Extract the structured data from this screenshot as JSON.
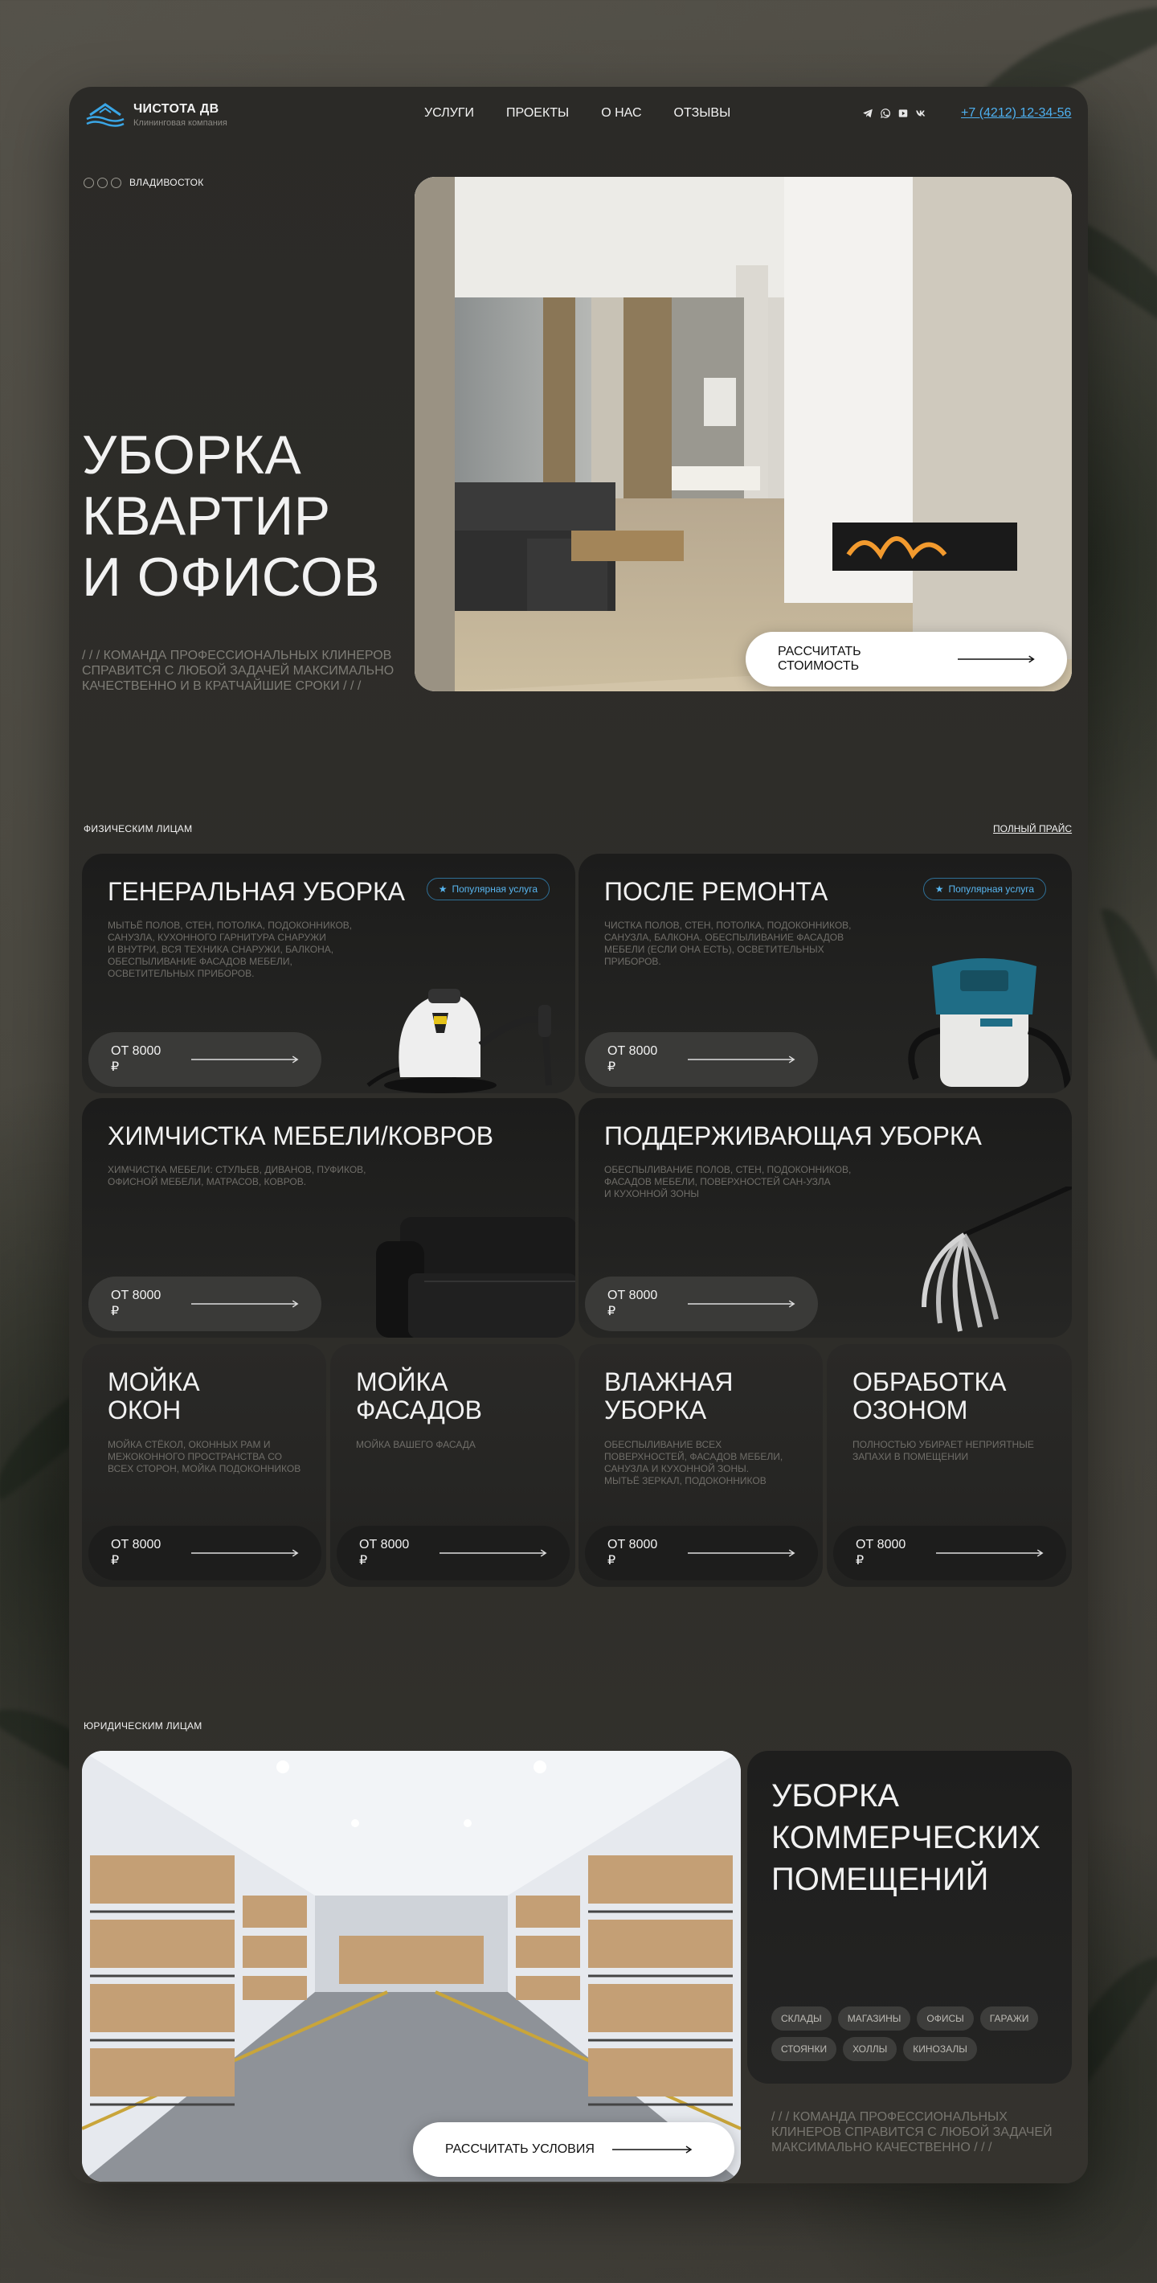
{
  "brand": {
    "title": "ЧИСТОТА ДВ",
    "subtitle": "Клининговая компания"
  },
  "nav": [
    "УСЛУГИ",
    "ПРОЕКТЫ",
    "О НАС",
    "ОТЗЫВЫ"
  ],
  "phone": "+7 (4212) 12-34-56",
  "socials": [
    "telegram-icon",
    "whatsapp-icon",
    "youtube-icon",
    "vk-icon"
  ],
  "hero": {
    "city": "ВЛАДИВОСТОК",
    "title": "УБОРКА\nКВАРТИР\nИ ОФИСОВ",
    "subtitle": "/ / / КОМАНДА ПРОФЕССИОНАЛЬНЫХ КЛИНЕРОВ СПРАВИТСЯ С ЛЮБОЙ ЗАДАЧЕЙ МАКСИМАЛЬНО КАЧЕСТВЕННО И В КРАТЧАЙШИЕ СРОКИ / / /",
    "cta": "РАССЧИТАТЬ СТОИМОСТЬ"
  },
  "individuals": {
    "label": "ФИЗИЧЕСКИМ ЛИЦАМ",
    "full_price": "ПОЛНЫЙ ПРАЙС",
    "popular_badge": "Популярная услуга",
    "services": [
      {
        "title": "ГЕНЕРАЛЬНАЯ УБОРКА",
        "desc": "МЫТЬЁ ПОЛОВ, СТЕН, ПОТОЛКА, ПОДОКОННИКОВ,\nСАНУЗЛА, КУХОННОГО ГАРНИТУРА СНАРУЖИ\nИ ВНУТРИ, ВСЯ ТЕХНИКА СНАРУЖИ, БАЛКОНА,\nОБЕСПЫЛИВАНИЕ ФАСАДОВ МЕБЕЛИ,\nОСВЕТИТЕЛЬНЫХ ПРИБОРОВ.",
        "price": "ОТ 8000 ₽"
      },
      {
        "title": "ПОСЛЕ РЕМОНТА",
        "desc": "ЧИСТКА ПОЛОВ, СТЕН, ПОТОЛКА, ПОДОКОННИКОВ,\nСАНУЗЛА, БАЛКОНА. ОБЕСПЫЛИВАНИЕ ФАСАДОВ\nМЕБЕЛИ (ЕСЛИ ОНА ЕСТЬ), ОСВЕТИТЕЛЬНЫХ\nПРИБОРОВ.",
        "price": "ОТ 8000 ₽"
      },
      {
        "title": "ХИМЧИСТКА МЕБЕЛИ/КОВРОВ",
        "desc": "ХИМЧИСТКА МЕБЕЛИ: СТУЛЬЕВ, ДИВАНОВ, ПУФИКОВ,\nОФИСНОЙ МЕБЕЛИ, МАТРАСОВ, КОВРОВ.",
        "price": "ОТ 8000 ₽"
      },
      {
        "title": "ПОДДЕРЖИВАЮЩАЯ УБОРКА",
        "desc": "ОБЕСПЫЛИВАНИЕ ПОЛОВ, СТЕН, ПОДОКОННИКОВ,\nФАСАДОВ МЕБЕЛИ, ПОВЕРХНОСТЕЙ САН-УЗЛА\nИ КУХОННОЙ ЗОНЫ",
        "price": "ОТ 8000 ₽"
      },
      {
        "title": "МОЙКА\nОКОН",
        "desc": "МОЙКА СТЁКОЛ, ОКОННЫХ РАМ И\nМЕЖОКОННОГО ПРОСТРАНСТВА СО\nВСЕХ СТОРОН, МОЙКА ПОДОКОННИКОВ",
        "price": "ОТ 8000 ₽"
      },
      {
        "title": "МОЙКА\nФАСАДОВ",
        "desc": "МОЙКА ВАШЕГО ФАСАДА",
        "price": "ОТ 8000 ₽"
      },
      {
        "title": "ВЛАЖНАЯ\nУБОРКА",
        "desc": "ОБЕСПЫЛИВАНИЕ ВСЕХ\nПОВЕРХНОСТЕЙ, ФАСАДОВ МЕБЕЛИ,\nСАНУЗЛА И КУХОННОЙ ЗОНЫ.\nМЫТЬЁ ЗЕРКАЛ, ПОДОКОННИКОВ",
        "price": "ОТ 8000 ₽"
      },
      {
        "title": "ОБРАБОТКА\nОЗОНОМ",
        "desc": "ПОЛНОСТЬЮ УБИРАЕТ НЕПРИЯТНЫЕ\nЗАПАХИ В ПОМЕЩЕНИИ",
        "price": "ОТ 8000 ₽"
      }
    ]
  },
  "business": {
    "label": "ЮРИДИЧЕСКИМ ЛИЦАМ",
    "title": "УБОРКА\nКОММЕРЧЕСКИХ\nПОМЕЩЕНИЙ",
    "tags": [
      "СКЛАДЫ",
      "МАГАЗИНЫ",
      "ОФИСЫ",
      "ГАРАЖИ",
      "СТОЯНКИ",
      "ХОЛЛЫ",
      "КИНОЗАЛЫ"
    ],
    "cta": "РАССЧИТАТЬ УСЛОВИЯ",
    "subtitle": "/ / / КОМАНДА ПРОФЕССИОНАЛЬНЫХ КЛИНЕРОВ СПРАВИТСЯ С ЛЮБОЙ ЗАДАЧЕЙ МАКСИМАЛЬНО КАЧЕСТВЕННО / / /"
  },
  "colors": {
    "accent": "#4eb0f0",
    "card": "#1f1f1e",
    "page": "#2e2d29"
  }
}
